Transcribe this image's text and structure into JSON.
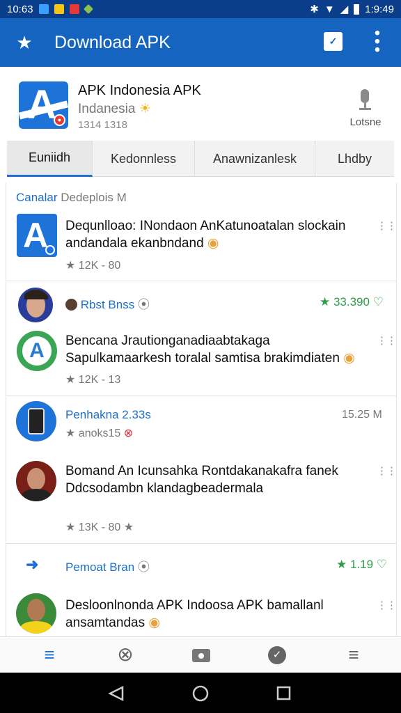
{
  "status_bar": {
    "time_left": "10:63",
    "time_right": "1:9:49"
  },
  "app_bar": {
    "title": "Download APK"
  },
  "header": {
    "app_name": "APK Indonesia APK",
    "subtitle": "Indanesia",
    "meta": "1314 1318",
    "mic_label": "Lotsne"
  },
  "tabs": [
    "Euniidh",
    "Kedonnless",
    "Anawnizanlesk",
    "Lhdby"
  ],
  "feed": {
    "section_label": "Canalar",
    "section_sub": "Dedeplois M",
    "item1": {
      "title": "Dequnlloao: INondaon AnKatunoatalan slockain andandala ekanbndand",
      "stats": "12K - 80"
    },
    "post2": {
      "name": "Rbst Bnss",
      "rating": "33.390",
      "title": "Bencana Jrautionganadiaabtakaga Sapulkamaarkesh toralal samtisa brakimdiaten",
      "stats": "12K - 13"
    },
    "post3": {
      "name": "Penhakna 2.33s",
      "time": "15.25 M",
      "sub": "anoks15",
      "title": "Bomand An Icunsahka Rontdakanakafra fanek Ddcsodambn klandagbeadermala",
      "stats": "13K - 80"
    },
    "post4": {
      "name": "Pemoat Bran",
      "rating": "1.19",
      "title": "Desloonlnonda APK Indoosa APK bamallanl ansamtandas"
    }
  },
  "colors": {
    "brand_blue": "#1565c0",
    "status_bar": "#0a3e8a",
    "green": "#2e9d4a"
  }
}
